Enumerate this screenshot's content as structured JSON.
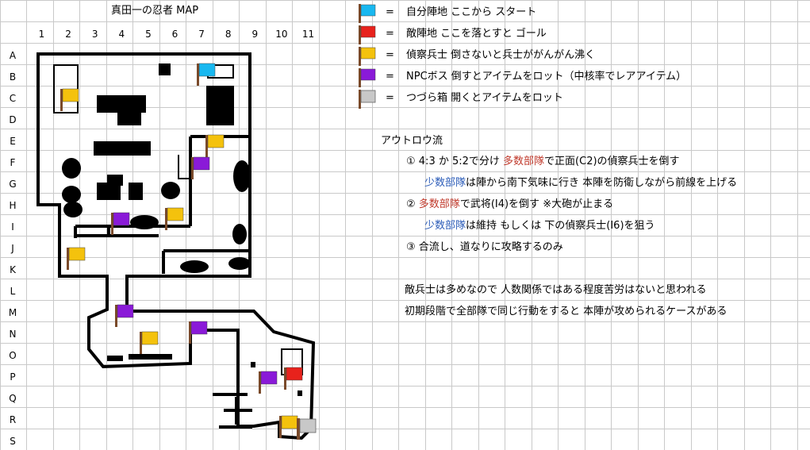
{
  "title": "真田一の忍者 MAP",
  "columns": [
    "1",
    "2",
    "3",
    "4",
    "5",
    "6",
    "7",
    "8",
    "9",
    "10",
    "11"
  ],
  "rows": [
    "A",
    "B",
    "C",
    "D",
    "E",
    "F",
    "G",
    "H",
    "I",
    "J",
    "K",
    "L",
    "M",
    "N",
    "O",
    "P",
    "Q",
    "R",
    "S"
  ],
  "legend": [
    {
      "eq": "=",
      "text": "自分陣地 ここから スタート",
      "color": "#19b8f0",
      "icon": "flag-icon"
    },
    {
      "eq": "=",
      "text": "敵陣地 ここを落とすと ゴール",
      "color": "#e8221c",
      "icon": "flag-icon"
    },
    {
      "eq": "=",
      "text": "偵察兵士 倒さないと兵士ががんがん沸く",
      "color": "#f4c20d",
      "icon": "flag-icon"
    },
    {
      "eq": "=",
      "text": "NPCボス 倒すとアイテムをロット（中核率でレアアイテム）",
      "color": "#8a1ad8",
      "icon": "flag-icon"
    },
    {
      "eq": "=",
      "text": "つづら箱 開くとアイテムをロット",
      "color": "#c8c8c8",
      "icon": "box-icon"
    }
  ],
  "strategy_title": "アウトロウ流",
  "strategy": {
    "s1a_pre": "① 4:3 か 5:2で分け ",
    "s1a_em": "多数部隊",
    "s1a_post": "で正面(C2)の偵察兵士を倒す",
    "s1b_em": "少数部隊",
    "s1b_post": "は陣から南下気味に行き 本陣を防衛しながら前線を上げる",
    "s2a_pre": "② ",
    "s2a_em": "多数部隊",
    "s2a_post": "で武将(I4)を倒す ※大砲が止まる",
    "s2b_em": "少数部隊",
    "s2b_post": "は維持 もしくは 下の偵察兵士(I6)を狙う",
    "s3": "③ 合流し、道なりに攻略するのみ"
  },
  "notes": [
    "敵兵士は多めなので 人数関係ではある程度苦労はないと思われる",
    "初期段階で全部隊で同じ行動をすると 本陣が攻められるケースがある"
  ],
  "colors": {
    "self_base": "#19b8f0",
    "enemy_base": "#e8221c",
    "scout": "#f4c20d",
    "boss": "#8a1ad8",
    "chest": "#c8c8c8",
    "emphasis_red": "#c0392b",
    "emphasis_blue": "#2a5bb8"
  }
}
